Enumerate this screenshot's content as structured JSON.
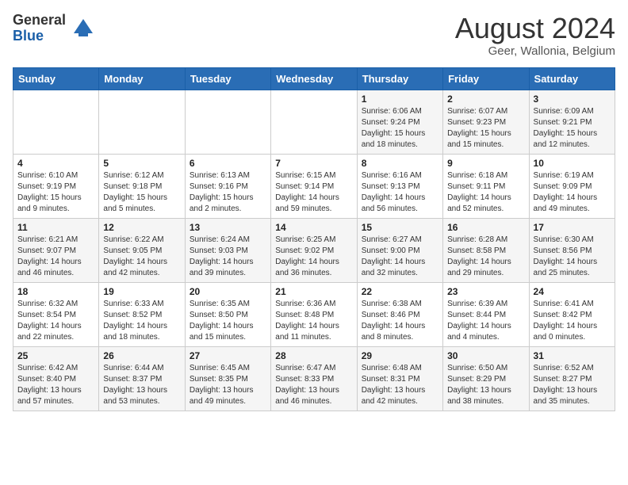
{
  "header": {
    "logo_general": "General",
    "logo_blue": "Blue",
    "month_title": "August 2024",
    "location": "Geer, Wallonia, Belgium"
  },
  "weekdays": [
    "Sunday",
    "Monday",
    "Tuesday",
    "Wednesday",
    "Thursday",
    "Friday",
    "Saturday"
  ],
  "weeks": [
    [
      {
        "day": "",
        "info": ""
      },
      {
        "day": "",
        "info": ""
      },
      {
        "day": "",
        "info": ""
      },
      {
        "day": "",
        "info": ""
      },
      {
        "day": "1",
        "info": "Sunrise: 6:06 AM\nSunset: 9:24 PM\nDaylight: 15 hours\nand 18 minutes."
      },
      {
        "day": "2",
        "info": "Sunrise: 6:07 AM\nSunset: 9:23 PM\nDaylight: 15 hours\nand 15 minutes."
      },
      {
        "day": "3",
        "info": "Sunrise: 6:09 AM\nSunset: 9:21 PM\nDaylight: 15 hours\nand 12 minutes."
      }
    ],
    [
      {
        "day": "4",
        "info": "Sunrise: 6:10 AM\nSunset: 9:19 PM\nDaylight: 15 hours\nand 9 minutes."
      },
      {
        "day": "5",
        "info": "Sunrise: 6:12 AM\nSunset: 9:18 PM\nDaylight: 15 hours\nand 5 minutes."
      },
      {
        "day": "6",
        "info": "Sunrise: 6:13 AM\nSunset: 9:16 PM\nDaylight: 15 hours\nand 2 minutes."
      },
      {
        "day": "7",
        "info": "Sunrise: 6:15 AM\nSunset: 9:14 PM\nDaylight: 14 hours\nand 59 minutes."
      },
      {
        "day": "8",
        "info": "Sunrise: 6:16 AM\nSunset: 9:13 PM\nDaylight: 14 hours\nand 56 minutes."
      },
      {
        "day": "9",
        "info": "Sunrise: 6:18 AM\nSunset: 9:11 PM\nDaylight: 14 hours\nand 52 minutes."
      },
      {
        "day": "10",
        "info": "Sunrise: 6:19 AM\nSunset: 9:09 PM\nDaylight: 14 hours\nand 49 minutes."
      }
    ],
    [
      {
        "day": "11",
        "info": "Sunrise: 6:21 AM\nSunset: 9:07 PM\nDaylight: 14 hours\nand 46 minutes."
      },
      {
        "day": "12",
        "info": "Sunrise: 6:22 AM\nSunset: 9:05 PM\nDaylight: 14 hours\nand 42 minutes."
      },
      {
        "day": "13",
        "info": "Sunrise: 6:24 AM\nSunset: 9:03 PM\nDaylight: 14 hours\nand 39 minutes."
      },
      {
        "day": "14",
        "info": "Sunrise: 6:25 AM\nSunset: 9:02 PM\nDaylight: 14 hours\nand 36 minutes."
      },
      {
        "day": "15",
        "info": "Sunrise: 6:27 AM\nSunset: 9:00 PM\nDaylight: 14 hours\nand 32 minutes."
      },
      {
        "day": "16",
        "info": "Sunrise: 6:28 AM\nSunset: 8:58 PM\nDaylight: 14 hours\nand 29 minutes."
      },
      {
        "day": "17",
        "info": "Sunrise: 6:30 AM\nSunset: 8:56 PM\nDaylight: 14 hours\nand 25 minutes."
      }
    ],
    [
      {
        "day": "18",
        "info": "Sunrise: 6:32 AM\nSunset: 8:54 PM\nDaylight: 14 hours\nand 22 minutes."
      },
      {
        "day": "19",
        "info": "Sunrise: 6:33 AM\nSunset: 8:52 PM\nDaylight: 14 hours\nand 18 minutes."
      },
      {
        "day": "20",
        "info": "Sunrise: 6:35 AM\nSunset: 8:50 PM\nDaylight: 14 hours\nand 15 minutes."
      },
      {
        "day": "21",
        "info": "Sunrise: 6:36 AM\nSunset: 8:48 PM\nDaylight: 14 hours\nand 11 minutes."
      },
      {
        "day": "22",
        "info": "Sunrise: 6:38 AM\nSunset: 8:46 PM\nDaylight: 14 hours\nand 8 minutes."
      },
      {
        "day": "23",
        "info": "Sunrise: 6:39 AM\nSunset: 8:44 PM\nDaylight: 14 hours\nand 4 minutes."
      },
      {
        "day": "24",
        "info": "Sunrise: 6:41 AM\nSunset: 8:42 PM\nDaylight: 14 hours\nand 0 minutes."
      }
    ],
    [
      {
        "day": "25",
        "info": "Sunrise: 6:42 AM\nSunset: 8:40 PM\nDaylight: 13 hours\nand 57 minutes."
      },
      {
        "day": "26",
        "info": "Sunrise: 6:44 AM\nSunset: 8:37 PM\nDaylight: 13 hours\nand 53 minutes."
      },
      {
        "day": "27",
        "info": "Sunrise: 6:45 AM\nSunset: 8:35 PM\nDaylight: 13 hours\nand 49 minutes."
      },
      {
        "day": "28",
        "info": "Sunrise: 6:47 AM\nSunset: 8:33 PM\nDaylight: 13 hours\nand 46 minutes."
      },
      {
        "day": "29",
        "info": "Sunrise: 6:48 AM\nSunset: 8:31 PM\nDaylight: 13 hours\nand 42 minutes."
      },
      {
        "day": "30",
        "info": "Sunrise: 6:50 AM\nSunset: 8:29 PM\nDaylight: 13 hours\nand 38 minutes."
      },
      {
        "day": "31",
        "info": "Sunrise: 6:52 AM\nSunset: 8:27 PM\nDaylight: 13 hours\nand 35 minutes."
      }
    ]
  ]
}
